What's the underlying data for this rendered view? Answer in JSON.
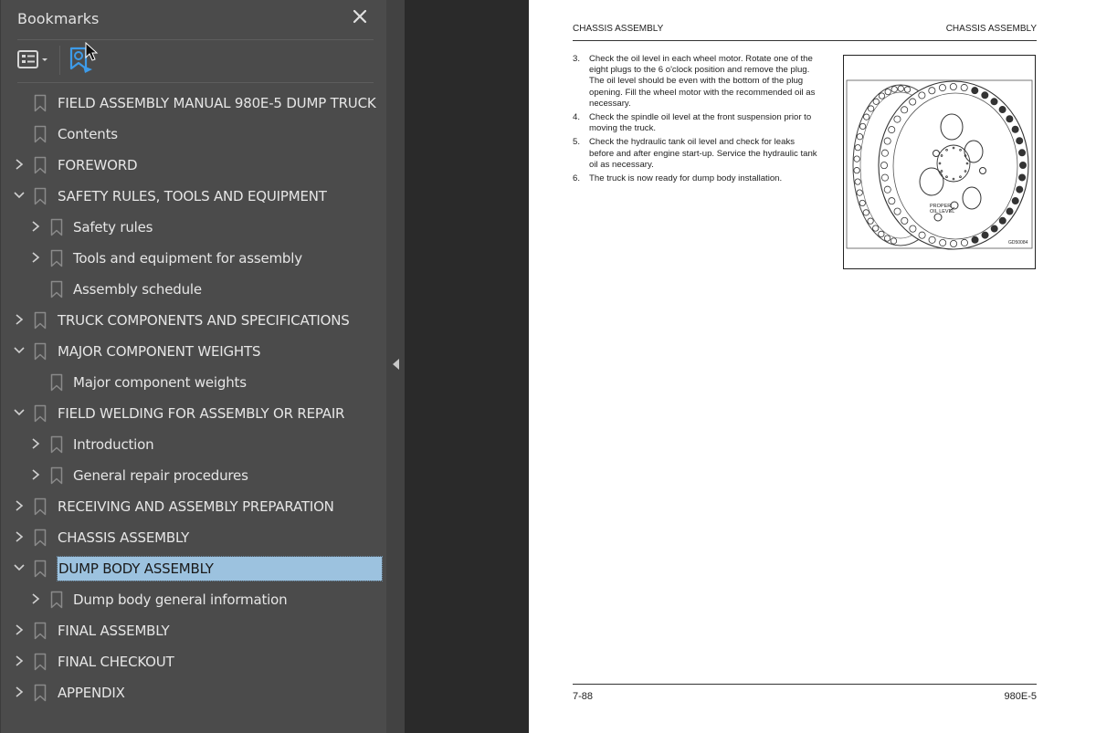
{
  "sidebar": {
    "title": "Bookmarks",
    "close_icon": "close-icon",
    "toolbar": {
      "options_icon": "list-options-icon",
      "find_current_icon": "find-current-bookmark-icon"
    },
    "accent_color": "#3d9be9",
    "selected_color": "#9cc2df",
    "items": [
      {
        "label": "FIELD ASSEMBLY MANUAL 980E-5 DUMP TRUCK",
        "level": 0,
        "expander": "none"
      },
      {
        "label": "Contents",
        "level": 0,
        "expander": "none"
      },
      {
        "label": "FOREWORD",
        "level": 0,
        "expander": "collapsed"
      },
      {
        "label": "SAFETY RULES, TOOLS AND EQUIPMENT",
        "level": 0,
        "expander": "expanded"
      },
      {
        "label": "Safety rules",
        "level": 1,
        "expander": "collapsed"
      },
      {
        "label": "Tools and equipment for assembly",
        "level": 1,
        "expander": "collapsed"
      },
      {
        "label": "Assembly schedule",
        "level": 1,
        "expander": "none"
      },
      {
        "label": "TRUCK COMPONENTS AND SPECIFICATIONS",
        "level": 0,
        "expander": "collapsed"
      },
      {
        "label": "MAJOR COMPONENT WEIGHTS",
        "level": 0,
        "expander": "expanded"
      },
      {
        "label": "Major component weights",
        "level": 1,
        "expander": "none"
      },
      {
        "label": "FIELD WELDING FOR ASSEMBLY OR REPAIR",
        "level": 0,
        "expander": "expanded"
      },
      {
        "label": "Introduction",
        "level": 1,
        "expander": "collapsed"
      },
      {
        "label": "General repair procedures",
        "level": 1,
        "expander": "collapsed"
      },
      {
        "label": "RECEIVING AND ASSEMBLY PREPARATION",
        "level": 0,
        "expander": "collapsed"
      },
      {
        "label": "CHASSIS ASSEMBLY",
        "level": 0,
        "expander": "collapsed"
      },
      {
        "label": "DUMP BODY ASSEMBLY",
        "level": 0,
        "expander": "expanded",
        "selected": true
      },
      {
        "label": "Dump body general information",
        "level": 1,
        "expander": "collapsed"
      },
      {
        "label": "FINAL ASSEMBLY",
        "level": 0,
        "expander": "collapsed"
      },
      {
        "label": "FINAL CHECKOUT",
        "level": 0,
        "expander": "collapsed"
      },
      {
        "label": "APPENDIX",
        "level": 0,
        "expander": "collapsed"
      }
    ]
  },
  "collapse_strip": {
    "icon": "collapse-left-icon"
  },
  "page": {
    "header_left": "CHASSIS ASSEMBLY",
    "header_right": "CHASSIS ASSEMBLY",
    "steps": [
      {
        "num": "3.",
        "text": "Check the oil level in each wheel motor. Rotate one of the eight plugs to the 6 o'clock position and remove the plug. The oil level should be even with the bottom of the plug opening. Fill the wheel motor with the recommended oil as necessary."
      },
      {
        "num": "4.",
        "text": "Check the spindle oil level at the front suspension prior to moving the truck."
      },
      {
        "num": "5.",
        "text": "Check the hydraulic tank oil level and check for leaks before and after engine start-up. Service the hydraulic tank oil as necessary."
      },
      {
        "num": "6.",
        "text": "The truck is now ready for dump body installation."
      }
    ],
    "figure": {
      "callout_line1": "PROPER",
      "callout_line2": "OIL LEVEL",
      "figure_id": "GD50084"
    },
    "footer_left": "7-88",
    "footer_right": "980E-5"
  }
}
